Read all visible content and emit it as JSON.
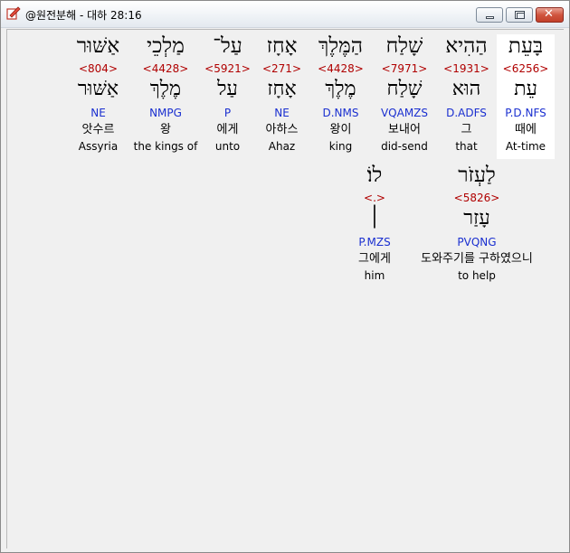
{
  "window": {
    "title": "@원전분해 - 대하 28:16",
    "icon": "app-icon",
    "buttons": {
      "minimize": "minimize-icon",
      "maximize": "maximize-icon",
      "close": "close-icon"
    }
  },
  "colors": {
    "strong": "#b00000",
    "morph": "#1a2fd0",
    "highlight": "#ffffff"
  },
  "words": [
    {
      "hebrew": "בָּעֵת",
      "strong": "<6256>",
      "lemma": "עֵת",
      "morph": "P.D.NFS",
      "korean": "때에",
      "english": "At-time"
    },
    {
      "hebrew": "הַהִיא",
      "strong": "<1931>",
      "lemma": "הוּא",
      "morph": "D.ADFS",
      "korean": "그",
      "english": "that"
    },
    {
      "hebrew": "שָׁלַח",
      "strong": "<7971>",
      "lemma": "שָׁלַח",
      "morph": "VQAMZS",
      "korean": "보내어",
      "english": "did-send"
    },
    {
      "hebrew": "הַמֶּלֶךְ",
      "strong": "<4428>",
      "lemma": "מֶלֶךְ",
      "morph": "D.NMS",
      "korean": "왕이",
      "english": "king"
    },
    {
      "hebrew": "אָחָז",
      "strong": "<271>",
      "lemma": "אָחָז",
      "morph": "NE",
      "korean": "아하스",
      "english": "Ahaz"
    },
    {
      "hebrew": "עַל־",
      "strong": "<5921>",
      "lemma": "עַל",
      "morph": "P",
      "korean": "에게",
      "english": "unto"
    },
    {
      "hebrew": "מַלְכֵי",
      "strong": "<4428>",
      "lemma": "מֶלֶךְ",
      "morph": "NMPG",
      "korean": "왕",
      "english": "the kings of"
    },
    {
      "hebrew": "אַשּׁוּר",
      "strong": "<804>",
      "lemma": "אַשּׁוּר",
      "morph": "NE",
      "korean": "앗수르",
      "english": "Assyria"
    },
    {
      "hebrew": "לַעְזֹר",
      "strong": "<5826>",
      "lemma": "עָזַר",
      "morph": "PVQNG",
      "korean": "도와주기를 구하였으니",
      "english": "to help"
    },
    {
      "hebrew": "לוֹ׃",
      "strong": "<.>",
      "lemma": "׀",
      "morph": "P.MZS",
      "korean": "그에게",
      "english": "him"
    }
  ]
}
